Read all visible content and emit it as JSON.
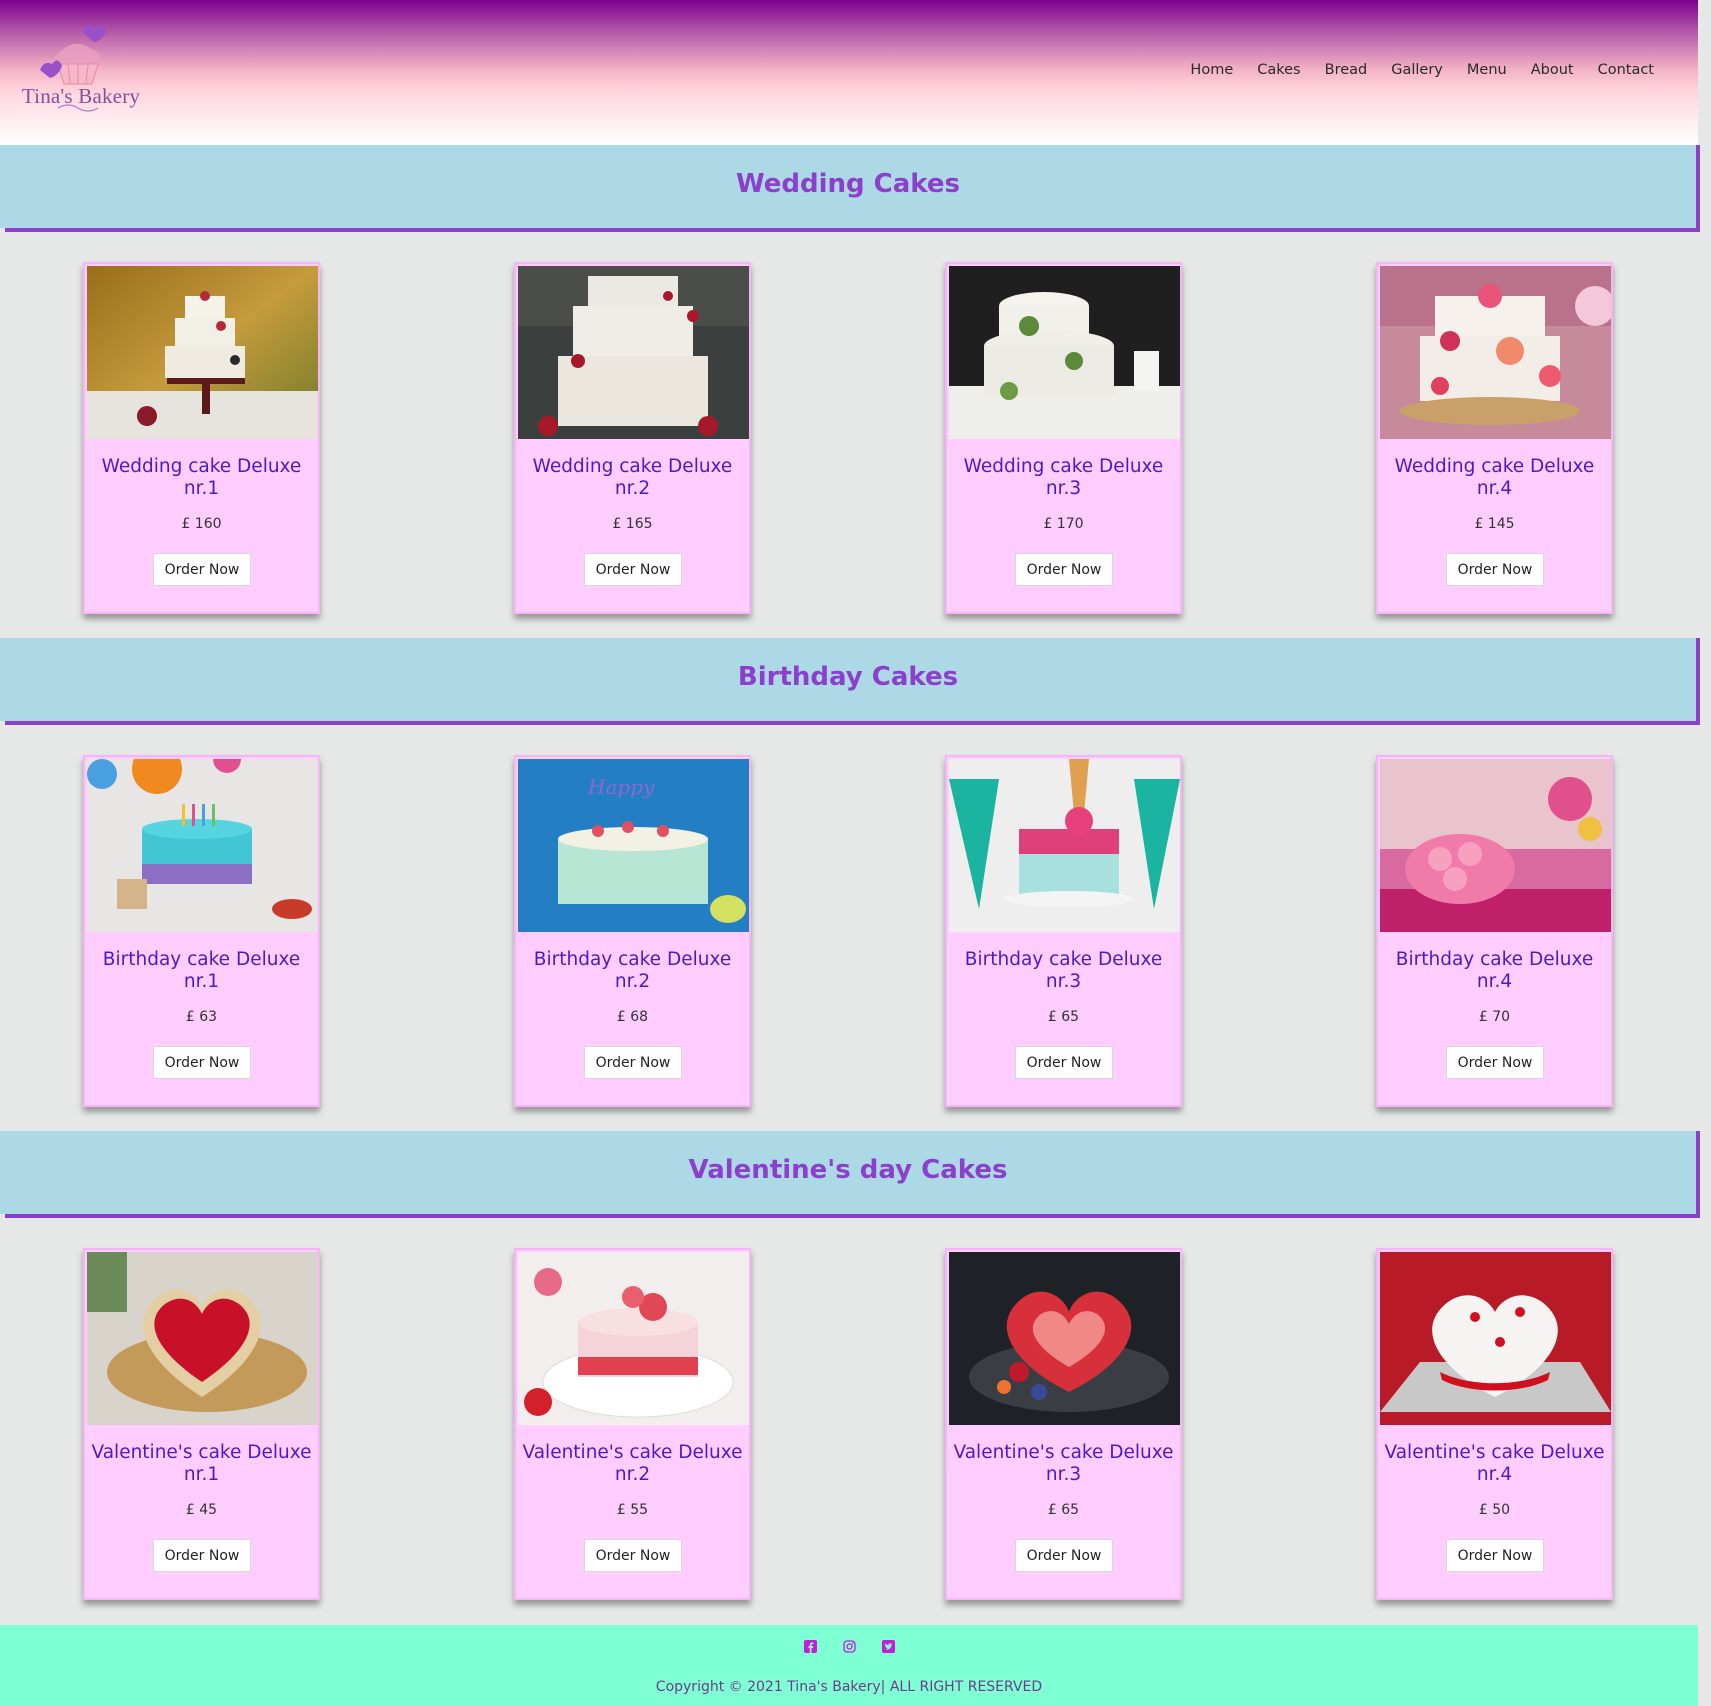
{
  "brand": {
    "name": "Tina's Bakery"
  },
  "nav": [
    {
      "label": "Home"
    },
    {
      "label": "Cakes"
    },
    {
      "label": "Bread"
    },
    {
      "label": "Gallery"
    },
    {
      "label": "Menu"
    },
    {
      "label": "About"
    },
    {
      "label": "Contact"
    }
  ],
  "sections": [
    {
      "title": "Wedding Cakes",
      "items": [
        {
          "name": "Wedding cake Deluxe nr.1",
          "price": "£ 160",
          "button": "Order Now"
        },
        {
          "name": "Wedding cake Deluxe nr.2",
          "price": "£ 165",
          "button": "Order Now"
        },
        {
          "name": "Wedding cake Deluxe nr.3",
          "price": "£ 170",
          "button": "Order Now"
        },
        {
          "name": "Wedding cake Deluxe nr.4",
          "price": "£ 145",
          "button": "Order Now"
        }
      ]
    },
    {
      "title": "Birthday Cakes",
      "items": [
        {
          "name": "Birthday cake Deluxe nr.1",
          "price": "£ 63",
          "button": "Order Now"
        },
        {
          "name": "Birthday cake Deluxe nr.2",
          "price": "£ 68",
          "button": "Order Now"
        },
        {
          "name": "Birthday cake Deluxe nr.3",
          "price": "£ 65",
          "button": "Order Now"
        },
        {
          "name": "Birthday cake Deluxe nr.4",
          "price": "£ 70",
          "button": "Order Now"
        }
      ]
    },
    {
      "title": "Valentine's day Cakes",
      "items": [
        {
          "name": "Valentine's cake Deluxe nr.1",
          "price": "£ 45",
          "button": "Order Now"
        },
        {
          "name": "Valentine's cake Deluxe nr.2",
          "price": "£ 55",
          "button": "Order Now"
        },
        {
          "name": "Valentine's cake Deluxe nr.3",
          "price": "£ 65",
          "button": "Order Now"
        },
        {
          "name": "Valentine's cake Deluxe nr.4",
          "price": "£ 50",
          "button": "Order Now"
        }
      ]
    }
  ],
  "footer": {
    "social": [
      "facebook-icon",
      "instagram-icon",
      "twitter-icon"
    ],
    "copyright": "Copyright © 2021 Tina's Bakery| ALL RIGHT RESERVED"
  },
  "colors": {
    "section_band": "#add8e6",
    "accent_purple": "#8b3fcb",
    "card_bg": "#ffcdff",
    "card_text": "#4a1bc4",
    "footer_bg": "#7fffd4"
  }
}
